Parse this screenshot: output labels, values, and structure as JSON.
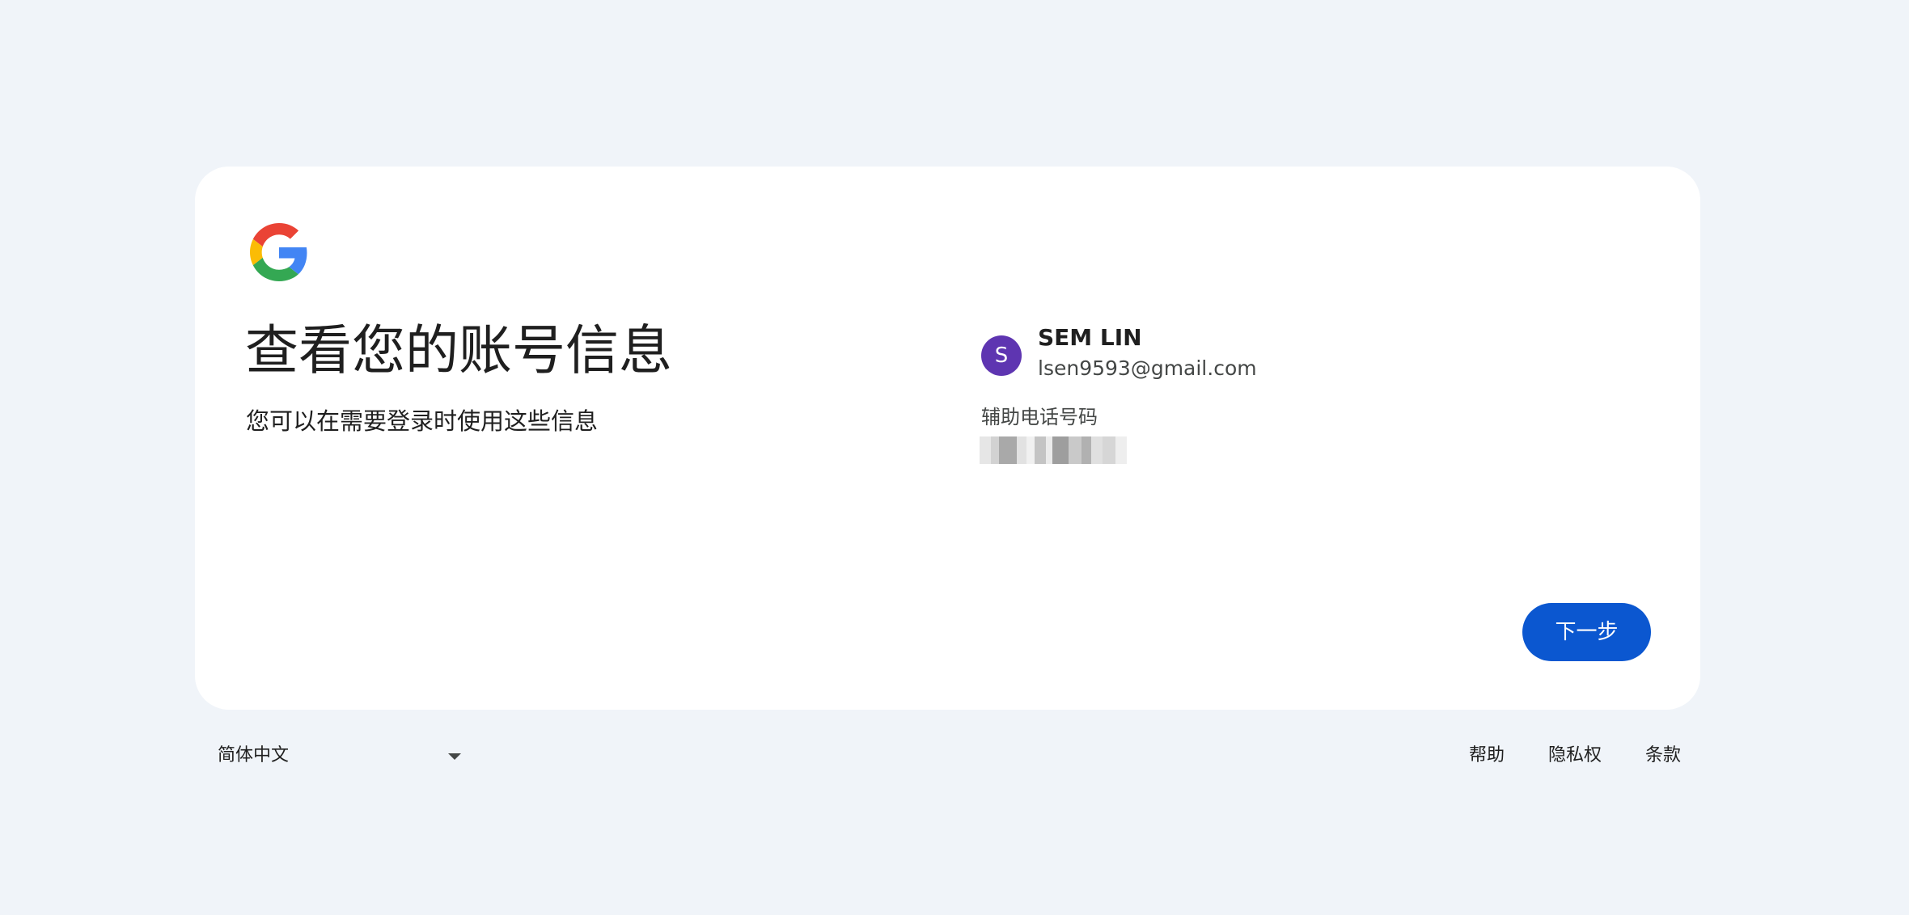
{
  "logo": {
    "icon": "google-g-logo"
  },
  "header": {
    "title": "查看您的账号信息",
    "subtitle": "您可以在需要登录时使用这些信息"
  },
  "account": {
    "avatar_initial": "S",
    "avatar_color": "#5e35b1",
    "name": "SEM LIN",
    "email": "lsen9593@gmail.com"
  },
  "recovery_phone": {
    "label": "辅助电话号码"
  },
  "actions": {
    "next_label": "下一步",
    "accent_color": "#0b57d0"
  },
  "footer": {
    "language": "简体中文",
    "links": [
      "帮助",
      "隐私权",
      "条款"
    ]
  }
}
